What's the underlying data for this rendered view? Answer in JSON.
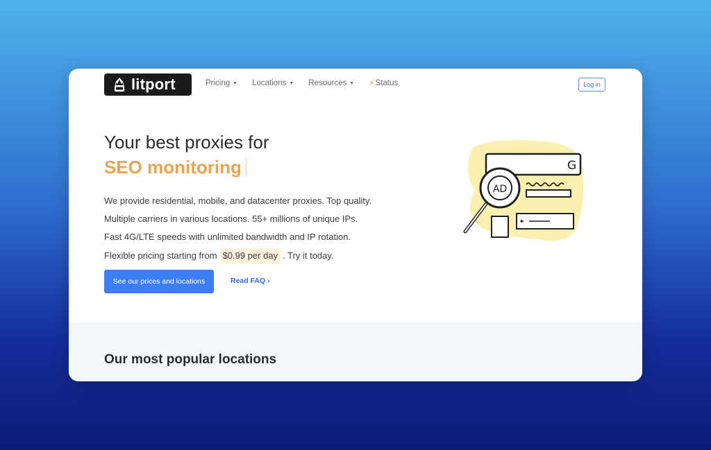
{
  "brand": {
    "name": "litport"
  },
  "nav": {
    "items": [
      {
        "label": "Pricing",
        "has_dropdown": true
      },
      {
        "label": "Locations",
        "has_dropdown": true
      },
      {
        "label": "Resources",
        "has_dropdown": true
      },
      {
        "label": "Status",
        "icon": "lightning-icon"
      }
    ],
    "login_label": "Log in"
  },
  "hero": {
    "headline": "Your best proxies for",
    "headline_accent": "SEO monitoring",
    "paragraphs": [
      "We provide residential, mobile, and datacenter proxies. Top quality.",
      "Multiple carriers in various locations. 55+ millions of unique IPs.",
      "Fast 4G/LTE speeds with unlimited bandwidth and IP rotation."
    ],
    "pricing_prefix": "Flexible pricing starting from",
    "pricing_highlight": "$0.99 per day",
    "pricing_suffix": ". Try it today.",
    "cta_label": "See our prices and locations",
    "faq_label": "Read FAQ ›"
  },
  "illustration": {
    "badge_text": "AD",
    "search_letter": "G"
  },
  "locations_section": {
    "title": "Our most popular locations"
  },
  "colors": {
    "accent_orange": "#f0a04e",
    "primary_blue": "#3d7ff3",
    "link_blue": "#3568d8",
    "highlight_yellow": "#fdf2dd"
  }
}
